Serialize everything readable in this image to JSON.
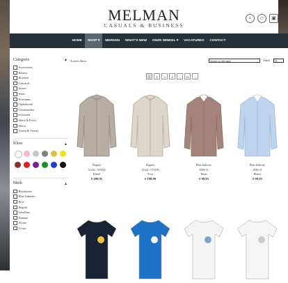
{
  "brand": {
    "name": "MELMAN",
    "tagline": "CASUALS & BUSINESS"
  },
  "header_icons": [
    "search-icon",
    "user-icon",
    "cart-icon"
  ],
  "nav": [
    "HOME",
    "SHOP ▾",
    "MERKEN",
    "WHAT'S NEW",
    "ONZE WINKEL ▾",
    "VACATURES",
    "CONTACT"
  ],
  "nav_active": "SHOP ▾",
  "filters": {
    "categorie": {
      "title": "Categorie",
      "items": [
        "Accessoires",
        "Blazers",
        "Broeken",
        "Giftcards",
        "Jassen",
        "Jeans",
        "Kostuums",
        "Onderbroek",
        "Overhemden",
        "Schoenen",
        "Shirts & Polo's",
        "Shorts",
        "Truien & Vesten"
      ]
    },
    "kleur": {
      "title": "Kleur",
      "colors": [
        "#ffffff",
        "#f5b8c8",
        "#c6c6c6",
        "#7f7f7f",
        "#d8c24a",
        "#f2e21b",
        "#8b2f2f",
        "#e02020",
        "#7a1f9a",
        "#1a8f2a",
        "#1f3fd6",
        "#111111"
      ]
    },
    "merk": {
      "title": "Merk",
      "items": [
        "Blackstone",
        "Bliss Industry",
        "Brax",
        "Bugatti",
        "Cavallaro",
        "Dunone",
        "Elvine",
        "G-star"
      ]
    }
  },
  "toolbar": {
    "active_filters": "Actieve filters:",
    "sort": "Sorteer op relevantie",
    "per_page_label": "Aantal",
    "per_page": "16"
  },
  "pagination": [
    "1",
    "2",
    "3",
    "4",
    "...",
    "31",
    "›"
  ],
  "products": [
    {
      "brand": "Bugatti",
      "code": "31244 / 376100",
      "color": "Kiezel",
      "price": "€ 209,95",
      "colors": [
        "#b8ada3",
        "#9a9087"
      ],
      "type": "jacket"
    },
    {
      "brand": "Bugatti",
      "code": "31244 / 373100",
      "color": "Ecru",
      "price": "€ 199,99",
      "colors": [
        "#dcd7c8",
        "#b9b3a3"
      ],
      "type": "jacket"
    },
    {
      "brand": "Bliss Industry",
      "code": "2839-31",
      "color": "Bruin",
      "price": "€ 99,95",
      "colors": [
        "#a4837a",
        "#8a6c62"
      ],
      "type": "shirt"
    },
    {
      "brand": "Bliss Industry",
      "code": "2839-31",
      "color": "Blauw",
      "price": "€ 99,95",
      "colors": [
        "#bdd4ec",
        "#9bb9db"
      ],
      "type": "shirt"
    },
    {
      "brand": "",
      "code": "",
      "color": "",
      "price": "",
      "colors": [
        "#1a2236",
        "#f1c343"
      ],
      "type": "tee"
    },
    {
      "brand": "",
      "code": "",
      "color": "",
      "price": "",
      "colors": [
        "#1f73c7",
        "#ffffff"
      ],
      "type": "tee"
    },
    {
      "brand": "",
      "code": "",
      "color": "",
      "price": "",
      "colors": [
        "#f4f4f4",
        "#7fa6c9"
      ],
      "type": "tee"
    },
    {
      "brand": "",
      "code": "",
      "color": "",
      "price": "",
      "colors": [
        "#f6f6f6",
        "#c9c9c9"
      ],
      "type": "tee"
    }
  ]
}
